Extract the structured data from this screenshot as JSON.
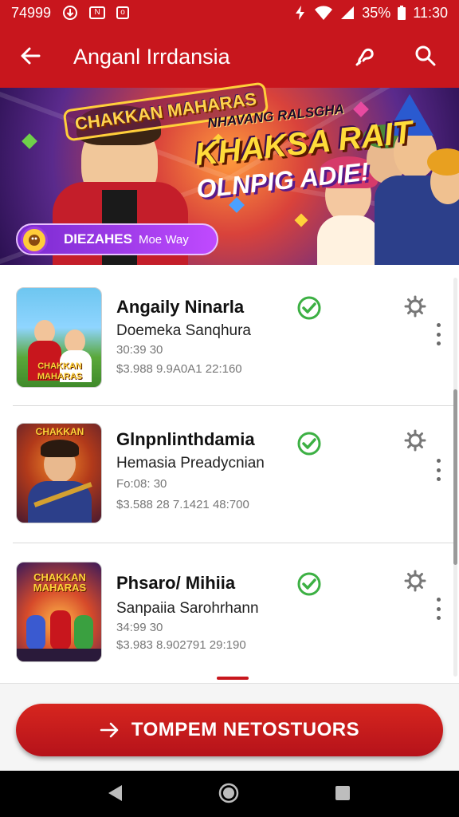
{
  "status_bar": {
    "time_left": "74999",
    "battery": "35%",
    "time_right": "11:30",
    "icons": [
      "download-icon",
      "mail-icon",
      "app-icon",
      "lightning-icon",
      "wifi-icon",
      "signal-icon",
      "battery-icon"
    ]
  },
  "app_bar": {
    "title": "Anganl Irrdansia",
    "back_icon": "arrow-left-icon",
    "actions": [
      "chat-icon",
      "search-icon"
    ]
  },
  "banner": {
    "logo_text": "CHAKKAN MAHARAS",
    "subtitle": "NHAVANG RALSGHA",
    "headline_line1": "KHAKSA RAIT",
    "headline_line2": "OLNPIG ADIE!",
    "pill_label": "DIEZAHES",
    "pill_sub": "Moe Way"
  },
  "list": {
    "items": [
      {
        "title": "Angaily Ninarla",
        "subtitle": "Doemeka Sanqhura",
        "meta1": "30:39 30",
        "meta2": "$3.988 9.9A0A1 22:160",
        "thumb_text": "CHAKKAN MAHARAS",
        "status_icon": "check-circle-icon"
      },
      {
        "title": "Glnpnlinthdamia",
        "subtitle": "Hemasia Preadycnian",
        "meta1": "Fo:08: 30",
        "meta2": "$3.588 28 7.1421 48:700",
        "thumb_text": "CHAKKAN",
        "status_icon": "check-circle-icon"
      },
      {
        "title": "Phsaro/ Mihiia",
        "subtitle": "Sanpaiia Sarohrhann",
        "meta1": "34:99 30",
        "meta2": "$3.983 8.902791 29:190",
        "thumb_text": "CHAKKAN MAHARAS",
        "status_icon": "check-circle-icon"
      }
    ]
  },
  "primary_button": {
    "label": "TOMPEM NETOSTUORS",
    "icon": "arrow-right-icon"
  },
  "nav_bar": [
    "back-triangle-icon",
    "home-circle-icon",
    "recents-square-icon"
  ],
  "colors": {
    "primary": "#c8161d",
    "check_green": "#3cb043"
  }
}
